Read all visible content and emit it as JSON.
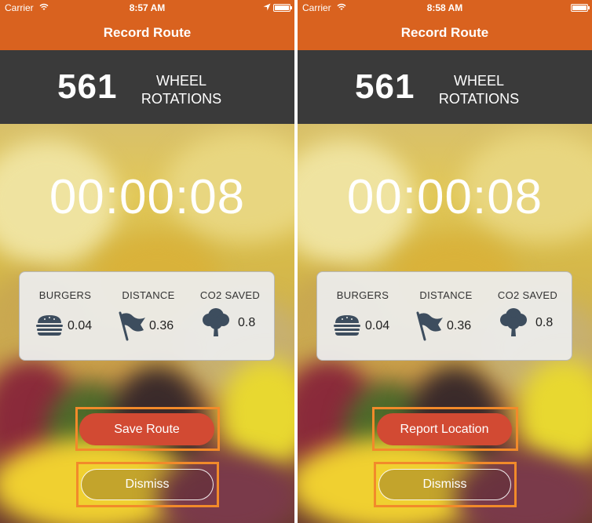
{
  "screens": [
    {
      "status": {
        "carrier": "Carrier",
        "time": "8:57 AM"
      },
      "nav_title": "Record Route",
      "rotations": {
        "count": "561",
        "label_line1": "WHEEL",
        "label_line2": "ROTATIONS"
      },
      "timer": "00:00:08",
      "stats": [
        {
          "title": "BURGERS",
          "value": "0.04",
          "icon": "burger-icon"
        },
        {
          "title": "DISTANCE",
          "value": "0.36",
          "icon": "flag-icon"
        },
        {
          "title": "CO2 SAVED",
          "value": "0.8",
          "icon": "tree-icon"
        }
      ],
      "primary_button": "Save Route",
      "dismiss_button": "Dismiss"
    },
    {
      "status": {
        "carrier": "Carrier",
        "time": "8:58 AM"
      },
      "nav_title": "Record Route",
      "rotations": {
        "count": "561",
        "label_line1": "WHEEL",
        "label_line2": "ROTATIONS"
      },
      "timer": "00:00:08",
      "stats": [
        {
          "title": "BURGERS",
          "value": "0.04",
          "icon": "burger-icon"
        },
        {
          "title": "DISTANCE",
          "value": "0.36",
          "icon": "flag-icon"
        },
        {
          "title": "CO2 SAVED",
          "value": "0.8",
          "icon": "tree-icon"
        }
      ],
      "primary_button": "Report Location",
      "dismiss_button": "Dismiss"
    }
  ],
  "colors": {
    "nav_orange": "#d9621f",
    "banner_dark": "#3a3a3a",
    "primary_red": "#d24a33",
    "highlight_orange": "#f28a2a",
    "icon_dark": "#3d4d5e"
  }
}
